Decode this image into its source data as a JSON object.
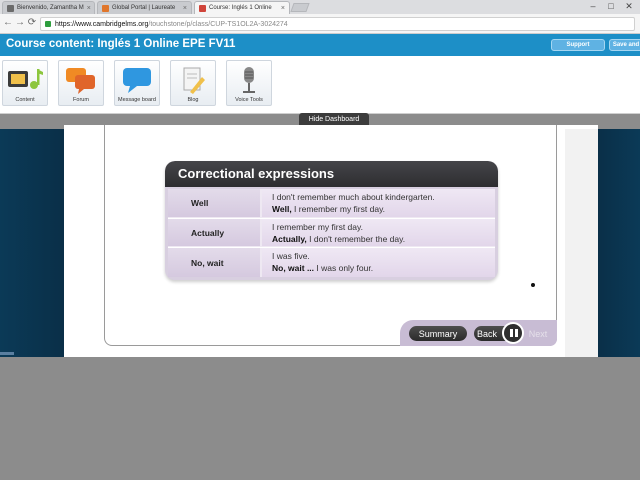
{
  "browser": {
    "tabs": [
      {
        "label": "Bienvenido, Zamantha M",
        "active": false,
        "favicon_color": "#6b6b6b"
      },
      {
        "label": "Global Portal | Laureate",
        "active": false,
        "favicon_color": "#e0762b"
      },
      {
        "label": "Course: Inglés 1 Online",
        "active": true,
        "favicon_color": "#d0443a"
      }
    ],
    "url_host": "https://www.cambridgelms.org",
    "url_path": "/touchstone/p/class/CUP-TS1OL2A-3024274",
    "window_controls": [
      "–",
      "□",
      "✕"
    ]
  },
  "course": {
    "title": "Course content: Inglés 1 Online EPE FV11",
    "support_label": "Support",
    "save_label": "Save and"
  },
  "dashboard": {
    "items": [
      {
        "label": "Content",
        "icon": "film-music-icon"
      },
      {
        "label": "Forum",
        "icon": "chat-bubbles-icon"
      },
      {
        "label": "Message board",
        "icon": "speech-bubble-icon"
      },
      {
        "label": "Blog",
        "icon": "pencil-paper-icon"
      },
      {
        "label": "Voice Tools",
        "icon": "microphone-icon"
      }
    ],
    "hide_label": "Hide Dashboard"
  },
  "lesson": {
    "title": "Correctional expressions",
    "rows": [
      {
        "expression": "Well",
        "line1": "I don't remember much about kindergarten.",
        "bold2": "Well,",
        "rest2": " I remember my first day."
      },
      {
        "expression": "Actually",
        "line1": "I remember my first day.",
        "bold2": "Actually,",
        "rest2": " I don't remember the day."
      },
      {
        "expression": "No, wait",
        "line1": "I was five.",
        "bold2": "No, wait ...",
        "rest2": " I was only four."
      }
    ]
  },
  "controls": {
    "summary_label": "Summary",
    "back_label": "Back",
    "next_label": "Next"
  },
  "colors": {
    "header_blue": "#1d8fc7",
    "card_lavender": "#d8cfe0",
    "card_head": "#3a3a3d"
  }
}
